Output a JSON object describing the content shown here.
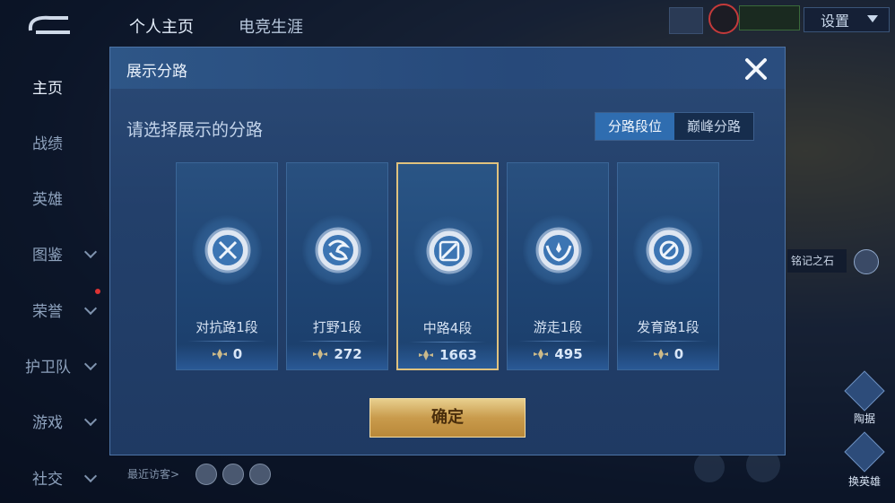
{
  "topbar": {
    "tabs": [
      "个人主页",
      "电竞生涯"
    ],
    "settings_label": "设置"
  },
  "sidebar": {
    "items": [
      "主页",
      "战绩",
      "英雄",
      "图鉴",
      "荣誉",
      "护卫队",
      "游戏",
      "社交"
    ]
  },
  "visitors_label": "最近访客>",
  "right_hud": {
    "stone_label": "铭记之石",
    "btn1_label": "陶据",
    "btn2_label": "换英雄"
  },
  "modal": {
    "title": "展示分路",
    "prompt": "请选择展示的分路",
    "toggle": [
      "分路段位",
      "巅峰分路"
    ],
    "toggle_active": "分路段位",
    "cards": [
      {
        "label": "对抗路1段",
        "score": "0",
        "icon": "swords-emblem-icon",
        "selected": false
      },
      {
        "label": "打野1段",
        "score": "272",
        "icon": "dragon-emblem-icon",
        "selected": false
      },
      {
        "label": "中路4段",
        "score": "1663",
        "icon": "wand-emblem-icon",
        "selected": true
      },
      {
        "label": "游走1段",
        "score": "495",
        "icon": "wings-emblem-icon",
        "selected": false
      },
      {
        "label": "发育路1段",
        "score": "0",
        "icon": "target-emblem-icon",
        "selected": false
      }
    ],
    "confirm_label": "确定"
  },
  "colors": {
    "accent_gold": "#e0c27e",
    "panel_blue": "#23406b",
    "toggle_active": "#2f6db0"
  }
}
